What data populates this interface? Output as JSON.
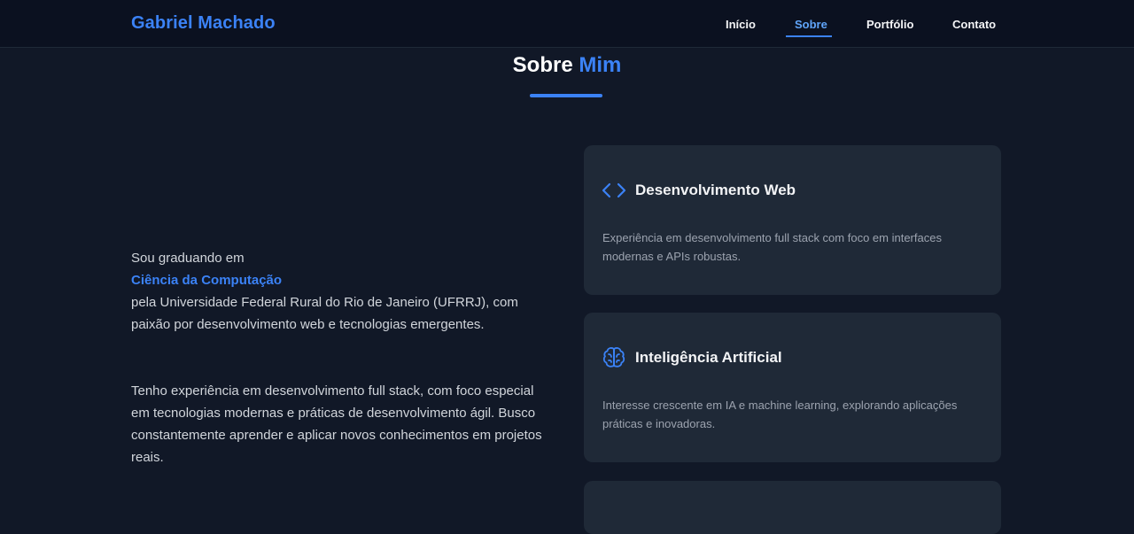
{
  "brand": "Gabriel Machado",
  "nav": {
    "items": [
      "Início",
      "Sobre",
      "Portfólio",
      "Contato"
    ],
    "active": "Sobre"
  },
  "section": {
    "title_prefix": "Sobre",
    "title_accent": "Mim"
  },
  "about": {
    "p1_before": "Sou graduando em",
    "p1_highlight": "Ciência da Computação",
    "p1_after": "pela Universidade Federal Rural do Rio de Janeiro (UFRRJ), com paixão por desenvolvimento web e tecnologias emergentes.",
    "p2": "Tenho experiência em desenvolvimento full stack, com foco especial em tecnologias modernas e práticas de desenvolvimento ágil. Busco constantemente aprender e aplicar novos conhecimentos em projetos reais."
  },
  "cards": [
    {
      "icon": "code-icon",
      "title": "Desenvolvimento Web",
      "desc": "Experiência em desenvolvimento full stack com foco em interfaces modernas e APIs robustas."
    },
    {
      "icon": "brain-icon",
      "title": "Inteligência Artificial",
      "desc": "Interesse crescente em IA e machine learning, explorando aplicações práticas e inovadoras."
    }
  ],
  "colors": {
    "accent": "#3b82f6",
    "background": "#111827",
    "card": "#1f2937",
    "navbar": "#0b1120"
  }
}
